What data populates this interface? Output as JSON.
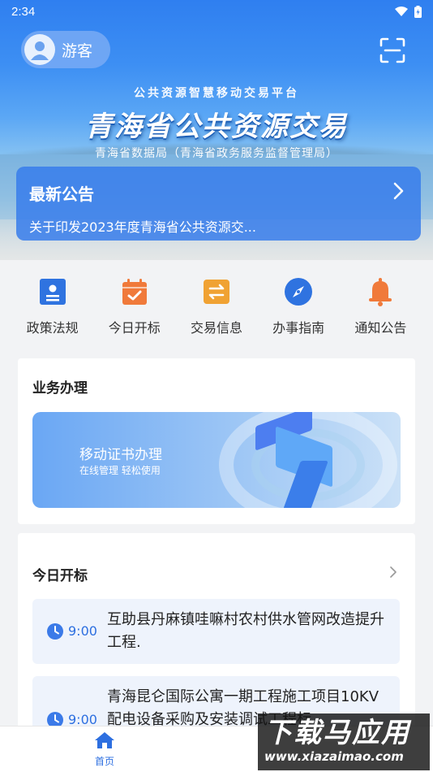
{
  "status_bar": {
    "time": "2:34"
  },
  "header": {
    "user_label": "游客",
    "subtitle": "公共资源智慧移动交易平台",
    "title": "青海省公共资源交易",
    "organization": "青海省数据局（青海省政务服务监督管理局）"
  },
  "notice": {
    "title": "最新公告",
    "text": "关于印发2023年度青海省公共资源交..."
  },
  "quick_nav": [
    {
      "label": "政策法规",
      "icon": "policy-icon",
      "color": "#2f73e0"
    },
    {
      "label": "今日开标",
      "icon": "calendar-check-icon",
      "color": "#f07a3a"
    },
    {
      "label": "交易信息",
      "icon": "exchange-icon",
      "color": "#f0a233"
    },
    {
      "label": "办事指南",
      "icon": "compass-icon",
      "color": "#2f73e0"
    },
    {
      "label": "通知公告",
      "icon": "bell-icon",
      "color": "#f07a3a"
    }
  ],
  "business": {
    "title": "业务办理",
    "banner_title": "移动证书办理",
    "banner_subtitle": "在线管理 轻松使用"
  },
  "today": {
    "title": "今日开标",
    "items": [
      {
        "time": "9:00",
        "name": "互助县丹麻镇哇嘛村农村供水管网改造提升工程."
      },
      {
        "time": "9:00",
        "name": "青海昆仑国际公寓一期工程施工项目10KV配电设备采购及安装调试工程标"
      }
    ]
  },
  "tabbar": {
    "home_label": "首页"
  },
  "watermark": {
    "line1": "下载马应用",
    "line2": "www.xiazaimao.com"
  },
  "colors": {
    "accent": "#2d6fe0",
    "background": "#f2f3f5"
  }
}
